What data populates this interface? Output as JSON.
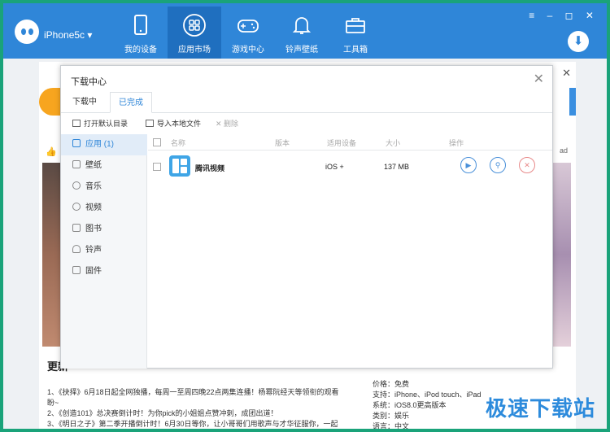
{
  "app": {
    "device_name": "iPhone5c ▾"
  },
  "nav": [
    {
      "label": "我的设备",
      "icon": "tablet-icon"
    },
    {
      "label": "应用市场",
      "icon": "apps-grid-icon",
      "active": true
    },
    {
      "label": "游戏中心",
      "icon": "gamepad-icon"
    },
    {
      "label": "铃声壁纸",
      "icon": "bell-icon"
    },
    {
      "label": "工具箱",
      "icon": "toolbox-icon"
    }
  ],
  "window_controls": "≡ – ◻ ✕",
  "background": {
    "update_title": "更新",
    "ad_label": "ad",
    "news": [
      "1、《抉择》6月18日起全网独播，每周一至周四晚22点两集连播！杨幂阮经天等领衔的观看盼~",
      "2、《创造101》总决赛倒计时！为你pick的小姐姐点赞冲刺，成团出道！",
      "3、《明日之子》第二季开播倒计时！6月30日等你，让小哥哥们用歌声与才华征服你，一起"
    ],
    "info": [
      "价格：免费",
      "支持：iPhone、iPod touch、iPad",
      "系统：iOS8.0更高版本",
      "类别：娱乐",
      "语言：中文"
    ],
    "watermark": "极速下载站"
  },
  "modal": {
    "title": "下载中心",
    "close": "✕",
    "tabs": [
      "下载中",
      "已完成"
    ],
    "active_tab": 1,
    "toolbar": {
      "open_dir": "打开默认目录",
      "import": "导入本地文件",
      "delete": "删除"
    },
    "sidebar": [
      {
        "label": "应用 (1)",
        "icon": "apps-grid-icon",
        "active": true
      },
      {
        "label": "壁纸",
        "icon": "image-icon"
      },
      {
        "label": "音乐",
        "icon": "music-disc-icon"
      },
      {
        "label": "视频",
        "icon": "play-circle-icon"
      },
      {
        "label": "图书",
        "icon": "book-icon"
      },
      {
        "label": "铃声",
        "icon": "bell-icon"
      },
      {
        "label": "固件",
        "icon": "box-icon"
      }
    ],
    "columns": [
      "名称",
      "版本",
      "适用设备",
      "大小",
      "操作"
    ],
    "rows": [
      {
        "name": "腾讯视频",
        "version": "",
        "device": "iOS +",
        "size": "137 MB"
      }
    ],
    "accent": "#2f86d8"
  }
}
